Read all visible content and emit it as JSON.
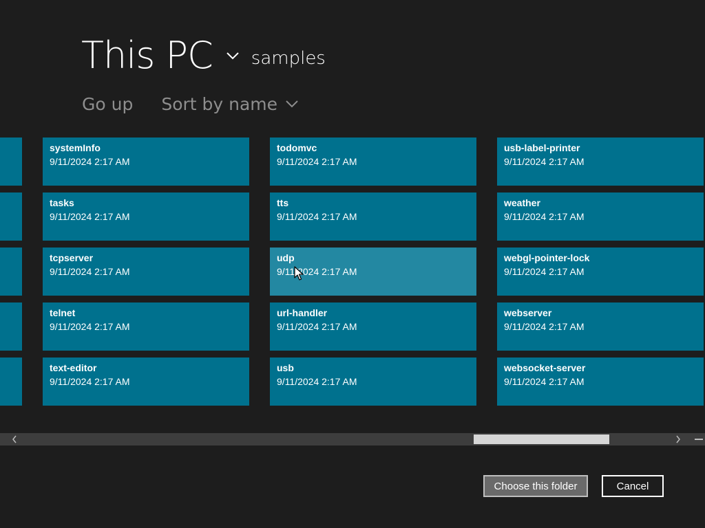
{
  "location": {
    "title": "This PC",
    "subfolder": "samples",
    "chevron_icon": "chevron-down-icon"
  },
  "commands": {
    "go_up": "Go up",
    "sort": "Sort by name",
    "sort_icon": "chevron-down-icon"
  },
  "folders": {
    "column_1": [
      {
        "name": "systemInfo",
        "date": "9/11/2024 2:17 AM"
      },
      {
        "name": "tasks",
        "date": "9/11/2024 2:17 AM"
      },
      {
        "name": "tcpserver",
        "date": "9/11/2024 2:17 AM"
      },
      {
        "name": "telnet",
        "date": "9/11/2024 2:17 AM"
      },
      {
        "name": "text-editor",
        "date": "9/11/2024 2:17 AM"
      }
    ],
    "column_2": [
      {
        "name": "todomvc",
        "date": "9/11/2024 2:17 AM"
      },
      {
        "name": "tts",
        "date": "9/11/2024 2:17 AM"
      },
      {
        "name": "udp",
        "date": "9/11/2024 2:17 AM"
      },
      {
        "name": "url-handler",
        "date": "9/11/2024 2:17 AM"
      },
      {
        "name": "usb",
        "date": "9/11/2024 2:17 AM"
      }
    ],
    "column_3": [
      {
        "name": "usb-label-printer",
        "date": "9/11/2024 2:17 AM"
      },
      {
        "name": "weather",
        "date": "9/11/2024 2:17 AM"
      },
      {
        "name": "webgl-pointer-lock",
        "date": "9/11/2024 2:17 AM"
      },
      {
        "name": "webserver",
        "date": "9/11/2024 2:17 AM"
      },
      {
        "name": "websocket-server",
        "date": "9/11/2024 2:17 AM"
      }
    ]
  },
  "hovered_folder": "udp",
  "scrollbar": {
    "left_icon": "chevron-left-icon",
    "right_icon": "chevron-right-icon",
    "end_icon": "minus-icon"
  },
  "buttons": {
    "choose": "Choose this folder",
    "cancel": "Cancel"
  },
  "colors": {
    "background": "#1d1d1d",
    "tile": "#00718e",
    "tile_hover": "#2388a2",
    "command_text": "#8e8e8e"
  }
}
